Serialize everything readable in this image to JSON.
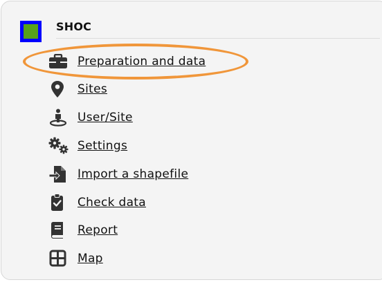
{
  "app": {
    "title": "SHOC",
    "logo_colors": {
      "border": "#0000ff",
      "fill": "#57a21a"
    }
  },
  "menu": {
    "items": [
      {
        "label": "Preparation and data",
        "icon": "briefcase-icon"
      },
      {
        "label": "Sites",
        "icon": "map-marker-icon"
      },
      {
        "label": "User/Site",
        "icon": "user-location-icon"
      },
      {
        "label": "Settings",
        "icon": "gears-icon"
      },
      {
        "label": "Import a shapefile",
        "icon": "file-import-icon"
      },
      {
        "label": "Check data",
        "icon": "clipboard-check-icon"
      },
      {
        "label": "Report",
        "icon": "book-icon"
      },
      {
        "label": "Map",
        "icon": "grid-icon"
      }
    ]
  },
  "annotation": {
    "highlight_color": "#f0963a"
  }
}
